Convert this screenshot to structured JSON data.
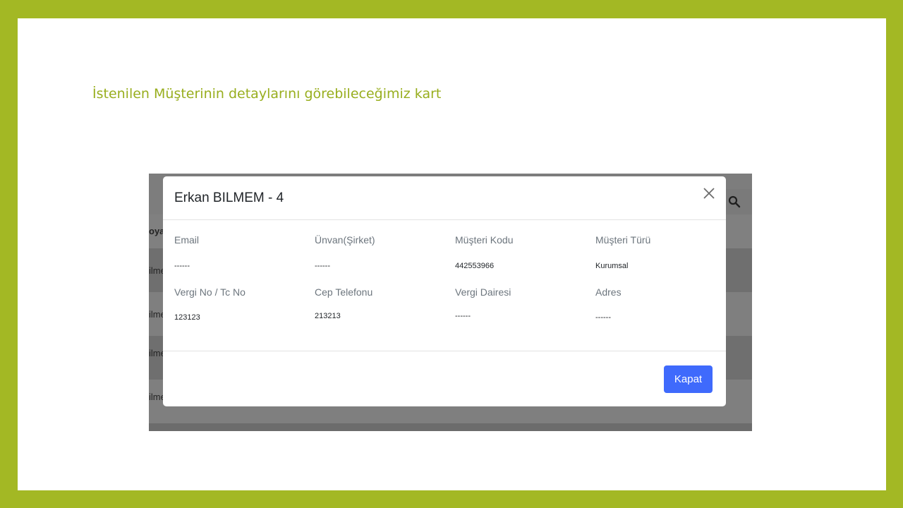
{
  "slide": {
    "caption": "İstenilen Müşterinin detaylarını görebileceğimiz kart"
  },
  "background_app": {
    "column_header_fragment": "oya",
    "row_fragments": [
      "ilme",
      "ilme",
      "ilme",
      "ilme"
    ],
    "search_icon": "search-icon"
  },
  "modal": {
    "title": "Erkan BILMEM - 4",
    "close_icon": "close-icon",
    "fields": [
      {
        "label": "Email",
        "value": "------"
      },
      {
        "label": "Ünvan(Şirket)",
        "value": "------"
      },
      {
        "label": "Müşteri Kodu",
        "value": "442553966"
      },
      {
        "label": "Müşteri Türü",
        "value": "Kurumsal"
      },
      {
        "label": "Vergi No / Tc No",
        "value": "123123"
      },
      {
        "label": "Cep Telefonu",
        "value": "213213"
      },
      {
        "label": "Vergi Dairesi",
        "value": "------"
      },
      {
        "label": "Adres",
        "value": "------"
      }
    ],
    "close_button_label": "Kapat",
    "accent_color": "#3f6afc"
  },
  "colors": {
    "frame": "#a3b824",
    "caption": "#98ae1e",
    "overlay": "#7d7d7d"
  }
}
